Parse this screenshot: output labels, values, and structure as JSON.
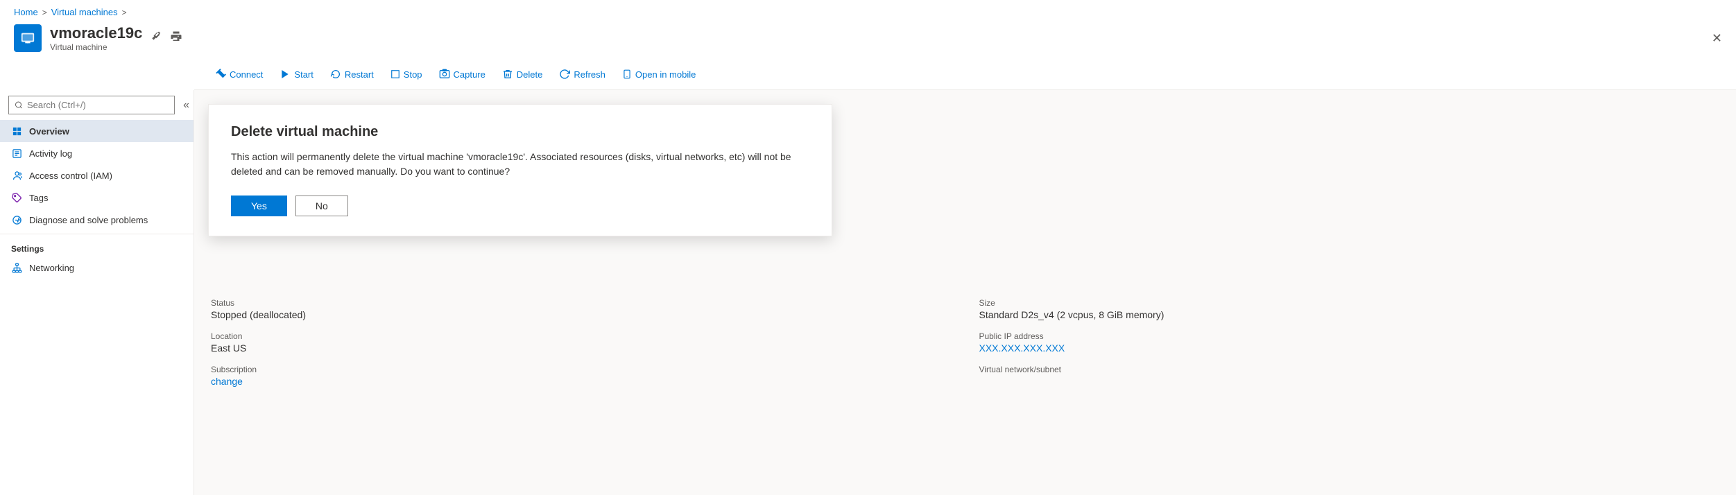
{
  "breadcrumb": {
    "home": "Home",
    "separator1": ">",
    "vms": "Virtual machines",
    "separator2": ">"
  },
  "page_header": {
    "vm_name": "vmoracle19c",
    "vm_subtitle": "Virtual machine",
    "pin_icon": "📌",
    "print_icon": "🖨"
  },
  "toolbar": {
    "connect_label": "Connect",
    "start_label": "Start",
    "restart_label": "Restart",
    "stop_label": "Stop",
    "capture_label": "Capture",
    "delete_label": "Delete",
    "refresh_label": "Refresh",
    "open_mobile_label": "Open in mobile"
  },
  "sidebar": {
    "search_placeholder": "Search (Ctrl+/)",
    "collapse_label": "«",
    "nav_items": [
      {
        "label": "Overview",
        "icon": "⊞",
        "active": true
      },
      {
        "label": "Activity log",
        "icon": "📋",
        "active": false
      },
      {
        "label": "Access control (IAM)",
        "icon": "👥",
        "active": false
      },
      {
        "label": "Tags",
        "icon": "🏷",
        "active": false
      },
      {
        "label": "Diagnose and solve problems",
        "icon": "🔧",
        "active": false
      }
    ],
    "settings_section": "Settings",
    "settings_items": [
      {
        "label": "Networking",
        "icon": "🌐",
        "active": false
      }
    ]
  },
  "dialog": {
    "title": "Delete virtual machine",
    "body": "This action will permanently delete the virtual machine 'vmoracle19c'. Associated resources (disks, virtual networks, etc) will not be deleted and can be removed manually. Do you want to continue?",
    "yes_label": "Yes",
    "no_label": "No"
  },
  "vm_details": {
    "status_label": "Status",
    "status_value": "Stopped (deallocated)",
    "location_label": "Location",
    "location_value": "East US",
    "subscription_label": "Subscription",
    "subscription_link": "change",
    "size_label": "Size",
    "size_value": "Standard D2s_v4 (2 vcpus, 8 GiB memory)",
    "public_ip_label": "Public IP address",
    "public_ip_value": "XXX.XXX.XXX.XXX",
    "vnet_label": "Virtual network/subnet"
  }
}
